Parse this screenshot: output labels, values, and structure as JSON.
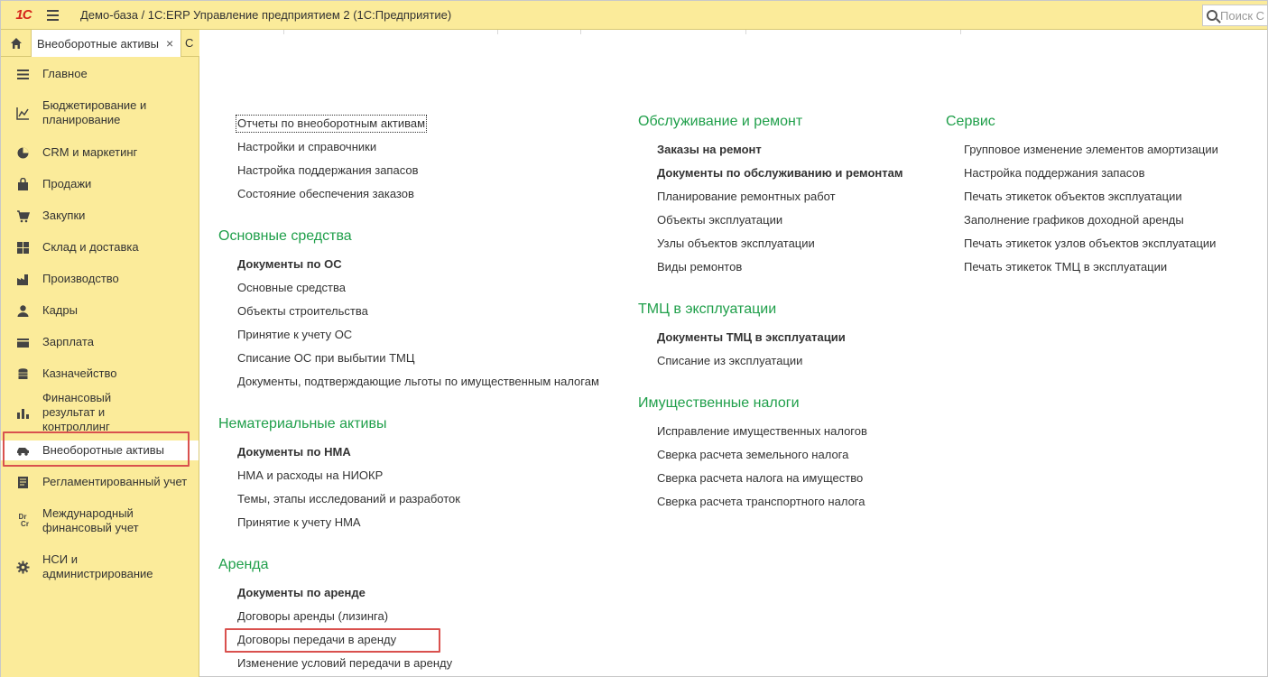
{
  "app": {
    "logo": "1С",
    "title": "Демо-база / 1С:ERP Управление предприятием 2  (1С:Предприятие)",
    "search_placeholder": "Поиск С"
  },
  "tabs": {
    "active_label": "Внеоборотные активы",
    "close": "×",
    "next_partial": "С"
  },
  "sidebar": {
    "items": [
      {
        "label": "Главное",
        "icon": "menu-list-icon"
      },
      {
        "label": "Бюджетирование и планирование",
        "icon": "chart-trend-icon"
      },
      {
        "label": "CRM и маркетинг",
        "icon": "pie-chart-icon"
      },
      {
        "label": "Продажи",
        "icon": "shopping-bag-icon"
      },
      {
        "label": "Закупки",
        "icon": "shopping-cart-icon"
      },
      {
        "label": "Склад и доставка",
        "icon": "warehouse-icon"
      },
      {
        "label": "Производство",
        "icon": "factory-icon"
      },
      {
        "label": "Кадры",
        "icon": "person-icon"
      },
      {
        "label": "Зарплата",
        "icon": "wallet-icon"
      },
      {
        "label": "Казначейство",
        "icon": "coins-icon"
      },
      {
        "label": "Финансовый результат и контроллинг",
        "icon": "bar-chart-icon"
      },
      {
        "label": "Внеоборотные активы",
        "icon": "car-icon"
      },
      {
        "label": "Регламентированный учет",
        "icon": "ledger-icon"
      },
      {
        "label": "Международный финансовый учет",
        "icon": "dr-cr-icon"
      },
      {
        "label": "НСИ и администрирование",
        "icon": "gear-icon"
      }
    ],
    "dr": "Dr",
    "cr": "Cr"
  },
  "main": {
    "col1_top_links": [
      "Отчеты по внеоборотным активам",
      "Настройки и справочники",
      "Настройка поддержания запасов",
      "Состояние обеспечения заказов"
    ],
    "os": {
      "title": "Основные средства",
      "links": [
        "Документы по ОС",
        "Основные средства",
        "Объекты строительства",
        "Принятие к учету ОС",
        "Списание ОС при выбытии ТМЦ",
        "Документы, подтверждающие льготы по имущественным налогам"
      ]
    },
    "nma": {
      "title": "Нематериальные активы",
      "links": [
        "Документы по НМА",
        "НМА и расходы на НИОКР",
        "Темы, этапы исследований и разработок",
        "Принятие к учету НМА"
      ]
    },
    "arenda": {
      "title": "Аренда",
      "links": [
        "Документы по аренде",
        "Договоры аренды (лизинга)",
        "Договоры передачи в аренду",
        "Изменение условий передачи в аренду"
      ]
    },
    "service_repair": {
      "title": "Обслуживание и ремонт",
      "links": [
        "Заказы на ремонт",
        "Документы по обслуживанию и ремонтам",
        "Планирование ремонтных работ",
        "Объекты эксплуатации",
        "Узлы объектов эксплуатации",
        "Виды ремонтов"
      ]
    },
    "tmc": {
      "title": "ТМЦ в эксплуатации",
      "links": [
        "Документы ТМЦ в эксплуатации",
        "Списание из эксплуатации"
      ]
    },
    "taxes": {
      "title": "Имущественные налоги",
      "links": [
        "Исправление имущественных налогов",
        "Сверка расчета земельного налога",
        "Сверка расчета налога на имущество",
        "Сверка расчета транспортного налога"
      ]
    },
    "servis": {
      "title": "Сервис",
      "links": [
        "Групповое изменение элементов амортизации",
        "Настройка поддержания запасов",
        "Печать этикеток объектов эксплуатации",
        "Заполнение графиков доходной аренды",
        "Печать этикеток узлов объектов эксплуатации",
        "Печать этикеток ТМЦ в эксплуатации"
      ]
    }
  },
  "colors": {
    "panel_bg": "#fbeb9a",
    "section_heading": "#1f9f4a",
    "highlight_box": "#d9514e"
  }
}
